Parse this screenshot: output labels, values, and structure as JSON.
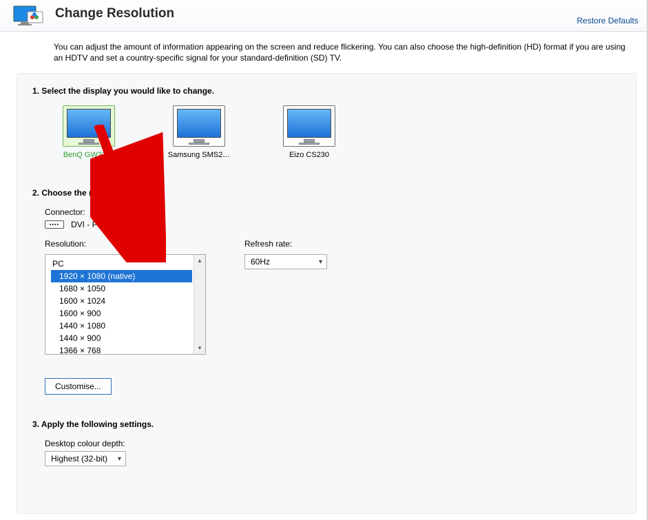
{
  "header": {
    "title": "Change Resolution",
    "restore_link": "Restore Defaults"
  },
  "intro": "You can adjust the amount of information appearing on the screen and reduce flickering. You can also choose the high-definition (HD) format if you are using an HDTV and set a country-specific signal for your standard-definition (SD) TV.",
  "sections": {
    "s1_title": "1. Select the display you would like to change.",
    "s2_title": "2. Choose the resolution.",
    "s3_title": "3. Apply the following settings."
  },
  "displays": [
    {
      "label": "BenQ GW2270",
      "selected": true
    },
    {
      "label": "Samsung SMS2…",
      "selected": false
    },
    {
      "label": "Eizo CS230",
      "selected": false
    }
  ],
  "connector": {
    "label": "Connector:",
    "value": "DVI - PC display"
  },
  "resolution": {
    "label": "Resolution:",
    "group": "PC",
    "items": [
      {
        "label": "1920 × 1080 (native)",
        "selected": true
      },
      {
        "label": "1680 × 1050",
        "selected": false
      },
      {
        "label": "1600 × 1024",
        "selected": false
      },
      {
        "label": "1600 × 900",
        "selected": false
      },
      {
        "label": "1440 × 1080",
        "selected": false
      },
      {
        "label": "1440 × 900",
        "selected": false
      },
      {
        "label": "1366 × 768",
        "selected": false
      }
    ]
  },
  "refresh": {
    "label": "Refresh rate:",
    "value": "60Hz"
  },
  "customise_label": "Customise...",
  "colour_depth": {
    "label": "Desktop colour depth:",
    "value": "Highest (32-bit)"
  }
}
